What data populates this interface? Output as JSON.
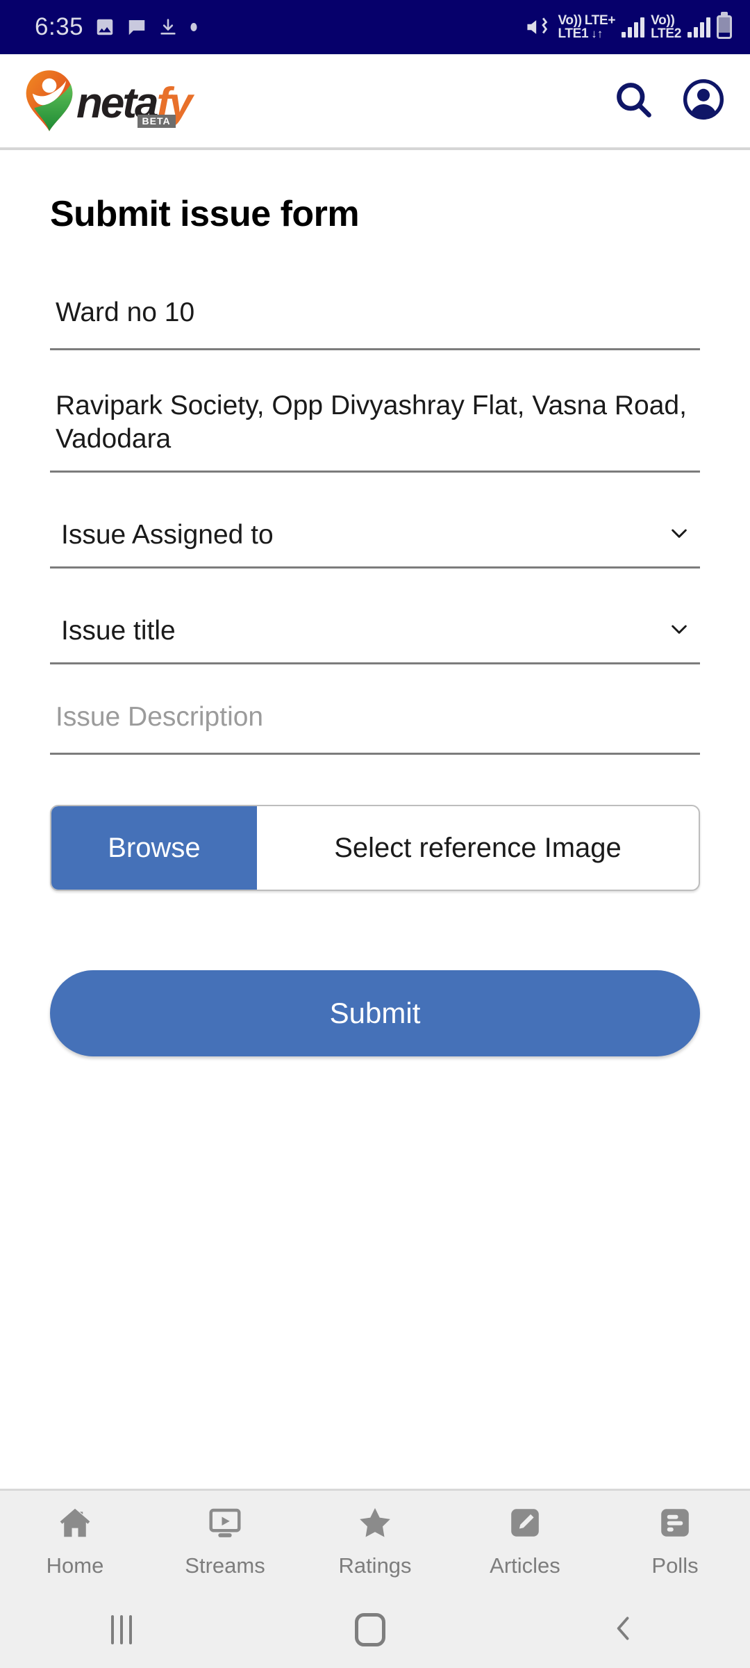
{
  "statusbar": {
    "time": "6:35",
    "left_icons": [
      "image-icon",
      "message-icon",
      "download-icon",
      "dot-icon"
    ],
    "mute_icon": "mute-icon",
    "sim1": {
      "volte": "Vo))",
      "network": "LTE+",
      "label": "LTE1",
      "data_arrows": "↓↑"
    },
    "sim2": {
      "volte": "Vo))",
      "label": "LTE2"
    },
    "battery_icon": "battery-icon",
    "background_color": "#06006b"
  },
  "header": {
    "logo": {
      "text_primary": "neta",
      "text_secondary": "fy",
      "badge": "BETA",
      "mark_icon": "location-pin-person-icon",
      "primary_color": "#231f20",
      "secondary_color": "#e8702a"
    },
    "search_icon": "search-icon",
    "account_icon": "account-circle-icon",
    "icon_color": "#0f1667"
  },
  "main": {
    "title": "Submit issue form",
    "fields": [
      {
        "name": "ward",
        "value": "Ward no 10",
        "type": "text"
      },
      {
        "name": "address",
        "value": "Ravipark Society, Opp Divyashray Flat, Vasna Road, Vadodara",
        "type": "text"
      },
      {
        "name": "issue-assigned-to",
        "value": "Issue Assigned to",
        "type": "select",
        "chevron": "chevron-down-icon"
      },
      {
        "name": "issue-title",
        "value": "Issue title",
        "type": "select",
        "chevron": "chevron-down-icon"
      },
      {
        "name": "issue-description",
        "placeholder": "Issue Description",
        "type": "text"
      }
    ],
    "file_picker": {
      "browse_label": "Browse",
      "file_label": "Select reference Image"
    },
    "submit_label": "Submit",
    "accent_color": "#4571b8"
  },
  "bottom_nav": {
    "items": [
      {
        "label": "Home",
        "icon": "home-icon"
      },
      {
        "label": "Streams",
        "icon": "monitor-play-icon"
      },
      {
        "label": "Ratings",
        "icon": "star-icon"
      },
      {
        "label": "Articles",
        "icon": "pencil-square-icon"
      },
      {
        "label": "Polls",
        "icon": "poll-bars-icon"
      }
    ]
  },
  "system_nav": {
    "recents_icon": "recents-icon",
    "home_icon": "home-square-icon",
    "back_icon": "back-chevron-icon"
  }
}
